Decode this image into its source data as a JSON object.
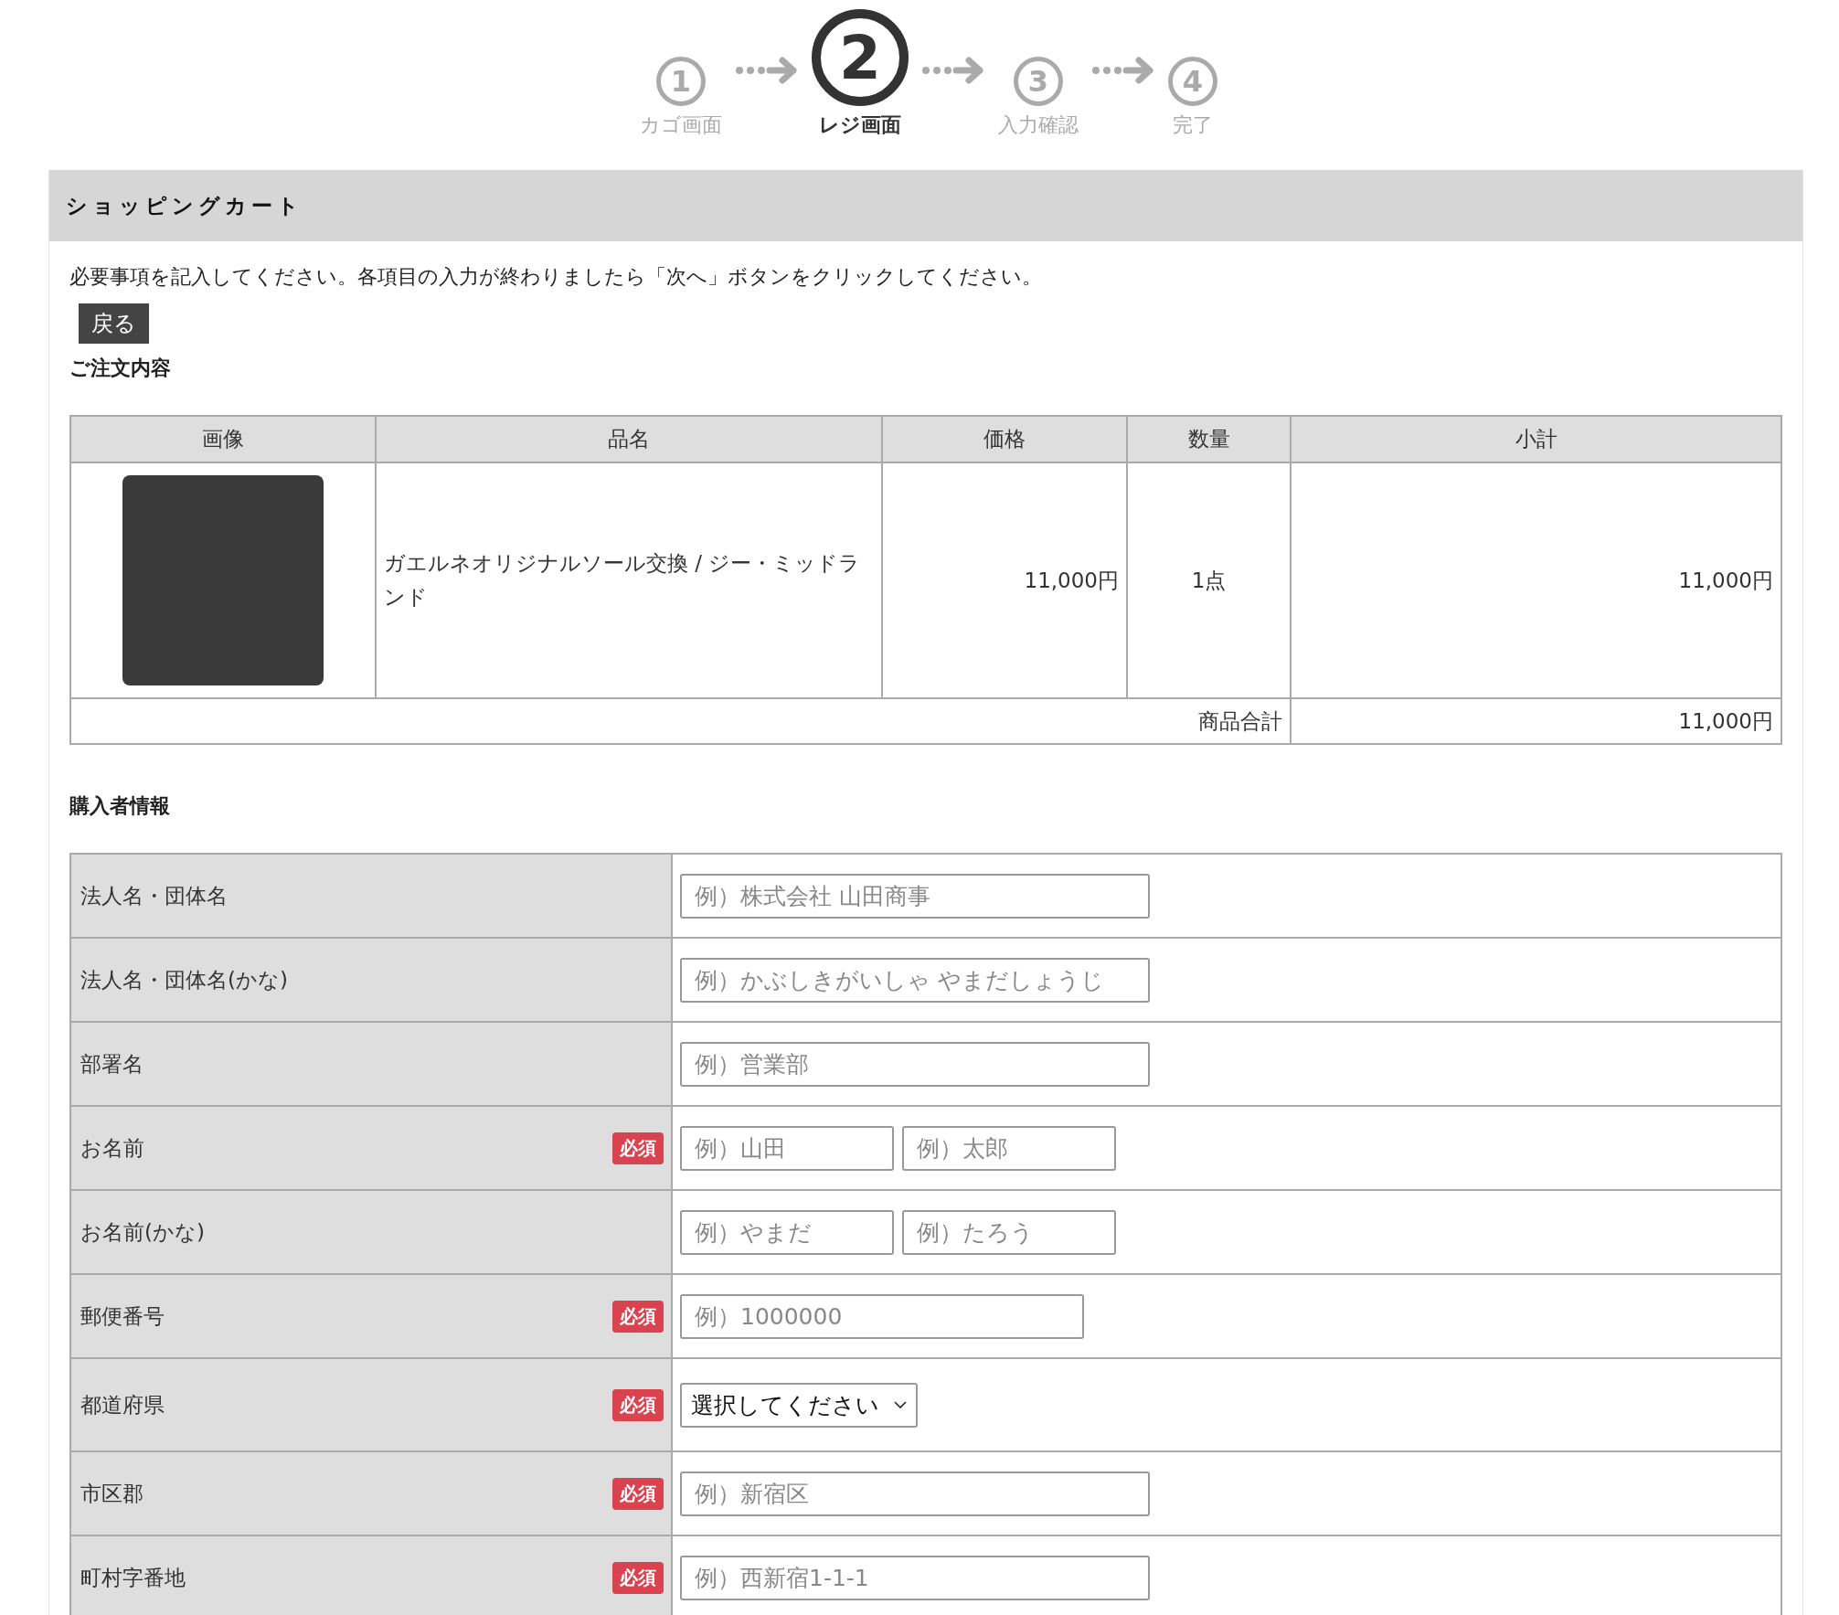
{
  "steps": [
    {
      "number": "1",
      "label": "カゴ画面",
      "selected": false
    },
    {
      "number": "2",
      "label": "レジ画面",
      "selected": true
    },
    {
      "number": "3",
      "label": "入力確認",
      "selected": false
    },
    {
      "number": "4",
      "label": "完了",
      "selected": false
    }
  ],
  "panel_title": "ショッピングカート",
  "instruction": "必要事項を記入してください。各項目の入力が終わりましたら「次へ」ボタンをクリックしてください。",
  "back_button": "戻る",
  "order_heading": "ご注文内容",
  "order_table": {
    "columns": [
      "画像",
      "品名",
      "価格",
      "数量",
      "小計"
    ],
    "rows": [
      {
        "name": "ガエルネオリジナルソール交換 / ジー・ミッドランド",
        "price": "11,000円",
        "quantity": "1点",
        "subtotal": "11,000円"
      }
    ],
    "total_label": "商品合計",
    "total": "11,000円"
  },
  "buyer_heading": "購入者情報",
  "form_rows": [
    {
      "label": "法人名・団体名",
      "required": false,
      "kind": "text",
      "fields": [
        {
          "placeholder": "例）株式会社 山田商事"
        }
      ]
    },
    {
      "label": "法人名・団体名(かな)",
      "required": false,
      "kind": "text",
      "fields": [
        {
          "placeholder": "例）かぶしきがいしゃ やまだしょうじ"
        }
      ]
    },
    {
      "label": "部署名",
      "required": false,
      "kind": "text",
      "fields": [
        {
          "placeholder": "例）営業部"
        }
      ]
    },
    {
      "label": "お名前",
      "required": true,
      "badge": "必須",
      "kind": "pair",
      "fields": [
        {
          "placeholder": "例）山田"
        },
        {
          "placeholder": "例）太郎"
        }
      ]
    },
    {
      "label": "お名前(かな)",
      "required": false,
      "kind": "pair",
      "fields": [
        {
          "placeholder": "例）やまだ"
        },
        {
          "placeholder": "例）たろう"
        }
      ]
    },
    {
      "label": "郵便番号",
      "required": true,
      "badge": "必須",
      "kind": "zip",
      "fields": [
        {
          "placeholder": "例）1000000"
        }
      ]
    },
    {
      "label": "都道府県",
      "required": true,
      "badge": "必須",
      "kind": "select",
      "value": "選択してください"
    },
    {
      "label": "市区郡",
      "required": true,
      "badge": "必須",
      "kind": "text",
      "fields": [
        {
          "placeholder": "例）新宿区"
        }
      ]
    },
    {
      "label": "町村字番地",
      "required": true,
      "badge": "必須",
      "kind": "text",
      "fields": [
        {
          "placeholder": "例）西新宿1-1-1"
        }
      ]
    }
  ]
}
